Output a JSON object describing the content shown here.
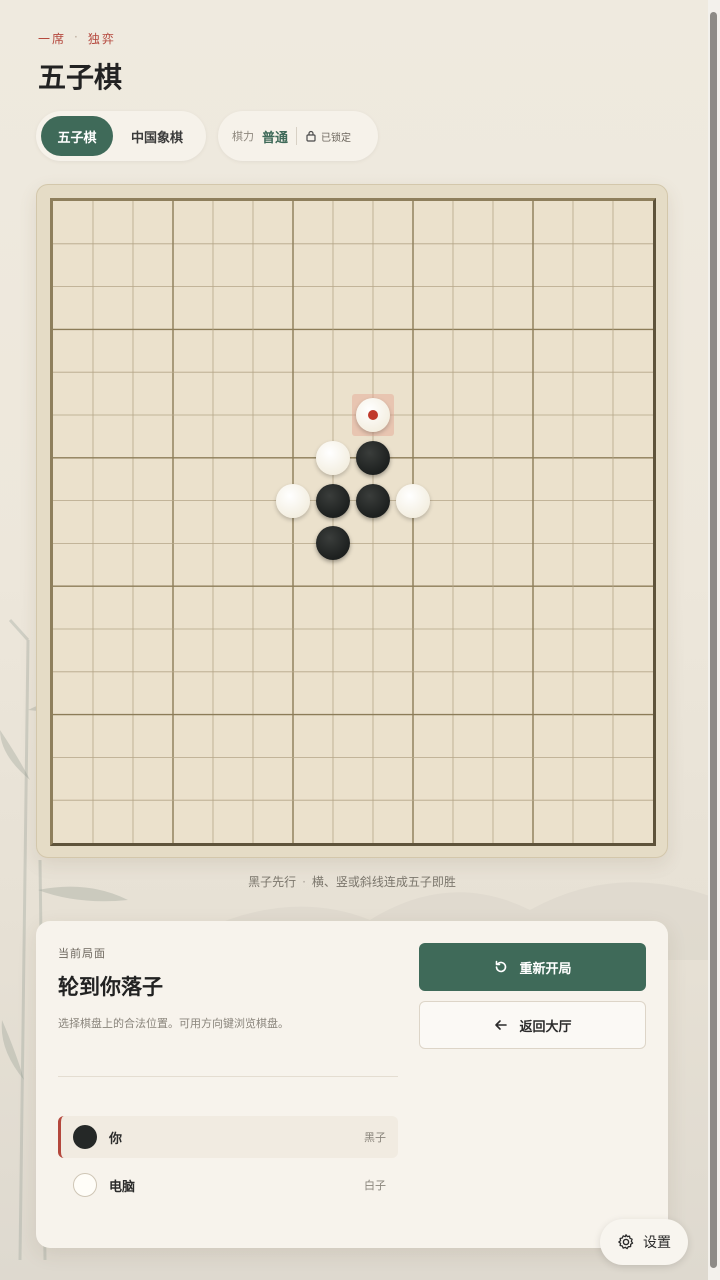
{
  "header": {
    "eyebrow_left": "一席",
    "eyebrow_dot": "·",
    "eyebrow_right": "独弈",
    "title": "五子棋"
  },
  "mode_tabs": [
    {
      "label": "五子棋",
      "active": true
    },
    {
      "label": "中国象棋",
      "active": false
    }
  ],
  "level": {
    "label": "棋力",
    "value": "普通",
    "lock_label": "已锁定",
    "lock_icon": "lock-icon"
  },
  "board": {
    "size": 15,
    "stones": [
      {
        "col": 8,
        "row": 5,
        "color": "white",
        "last_move": true
      },
      {
        "col": 7,
        "row": 6,
        "color": "white"
      },
      {
        "col": 8,
        "row": 6,
        "color": "black"
      },
      {
        "col": 6,
        "row": 7,
        "color": "white"
      },
      {
        "col": 7,
        "row": 7,
        "color": "black"
      },
      {
        "col": 8,
        "row": 7,
        "color": "black"
      },
      {
        "col": 9,
        "row": 7,
        "color": "white"
      },
      {
        "col": 7,
        "row": 8,
        "color": "black"
      }
    ]
  },
  "hint": {
    "left": "黑子先行",
    "sep": "·",
    "right": "横、竖或斜线连成五子即胜"
  },
  "status_panel": {
    "eyebrow": "当前局面",
    "title": "轮到你落子",
    "description": "选择棋盘上的合法位置。可用方向键浏览棋盘。",
    "players": [
      {
        "name": "你",
        "color_label": "黑子",
        "stone": "black",
        "current": true
      },
      {
        "name": "电脑",
        "color_label": "白子",
        "stone": "white",
        "current": false
      }
    ],
    "restart_label": "重新开局",
    "restart_icon": "restart-icon",
    "back_label": "返回大厅",
    "back_icon": "arrow-left-icon"
  },
  "settings": {
    "label": "设置",
    "icon": "gear-icon"
  },
  "colors": {
    "accent_green": "#3f6a59",
    "accent_red": "#b4473c",
    "board": "#ebe1cc"
  }
}
